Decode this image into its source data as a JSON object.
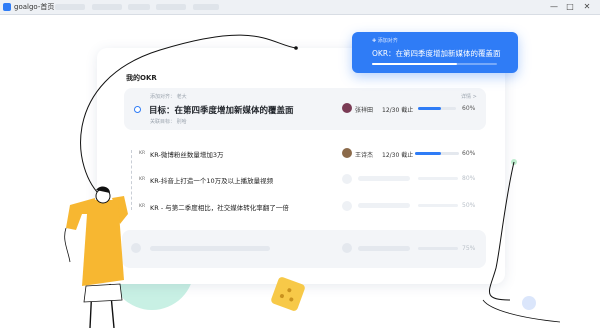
{
  "window": {
    "title": "goalgo-首页",
    "minimize_label": "—",
    "maximize_label": "□",
    "close_label": "✕"
  },
  "card": {
    "title": "我的OKR"
  },
  "objective": {
    "align_label": "添加对齐： 老大",
    "link_label": "详情 >",
    "title": "目标：在第四季度增加新媒体的覆盖面",
    "related_label": "关联目标： 别哈",
    "owner": "张祥田",
    "due": "12/30 截止",
    "progress_text": "60%",
    "progress": 0.6
  },
  "key_results": [
    {
      "tag": "KR",
      "text": "KR-微博粉丝数量增加3万",
      "owner": "王诗杰",
      "due": "12/30 截止",
      "progress_text": "60%",
      "progress": 0.6
    },
    {
      "tag": "KR",
      "text": "KR-抖音上打造一个10万及以上播放量视频",
      "progress_text": "80%"
    },
    {
      "tag": "KR",
      "text": "KR - 与第二季度相比，社交媒体转化率翻了一倍",
      "progress_text": "50%"
    }
  ],
  "bottom_row": {
    "progress_text": "75%"
  },
  "popup": {
    "label": "添加对齐",
    "title": "OKR：在第四季度增加新媒体的覆盖面",
    "progress": 0.68
  },
  "colors": {
    "accent": "#2f7cf6",
    "illustration_yellow": "#f7b731",
    "illustration_mint": "#c8f0e4"
  }
}
